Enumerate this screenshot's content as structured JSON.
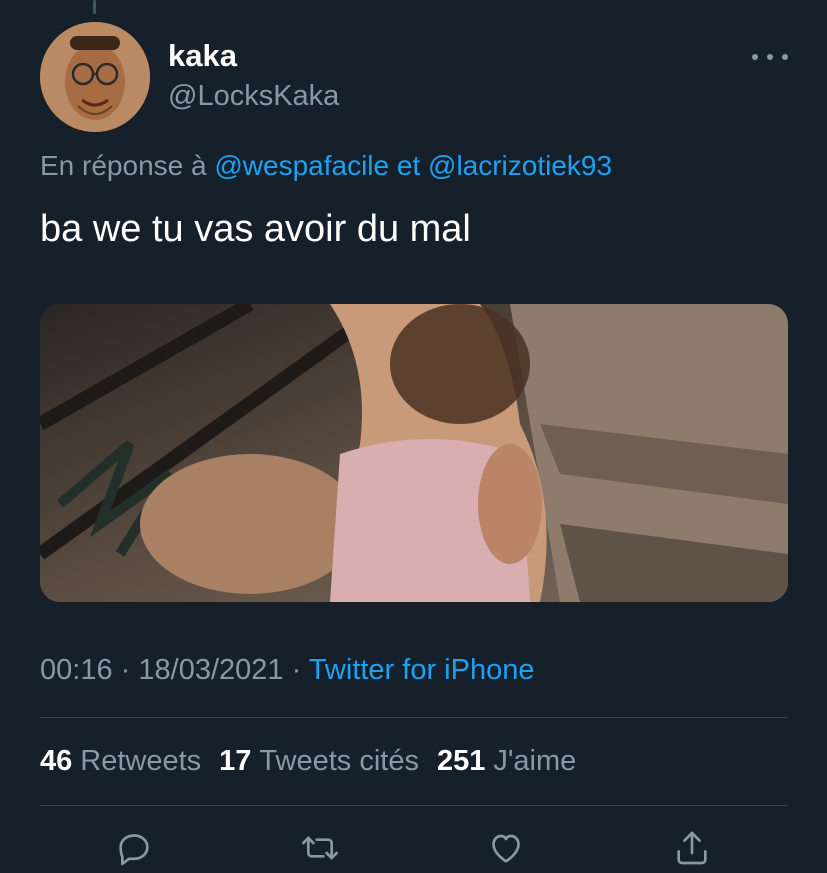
{
  "author": {
    "name": "kaka",
    "handle": "@LocksKaka"
  },
  "reply_context": {
    "prefix": "En réponse à",
    "mention1": "@wespafacile",
    "joiner": "et",
    "mention2": "@lacrizotiek93"
  },
  "tweet": {
    "text": "ba we tu vas avoir du mal"
  },
  "meta": {
    "time": "00:16",
    "separator": "·",
    "date": "18/03/2021",
    "source": "Twitter for iPhone"
  },
  "stats": {
    "retweets_count": "46",
    "retweets_label": "Retweets",
    "quotes_count": "17",
    "quotes_label": "Tweets cités",
    "likes_count": "251",
    "likes_label": "J'aime"
  },
  "icons": {
    "more": "more-dots-icon",
    "reply": "reply-bubble-icon",
    "retweet": "retweet-icon",
    "like": "heart-icon",
    "share": "share-icon"
  },
  "colors": {
    "background": "#15202b",
    "text_primary": "#ffffff",
    "text_secondary": "#8899a6",
    "accent": "#1da1f2",
    "divider": "#38444d"
  }
}
